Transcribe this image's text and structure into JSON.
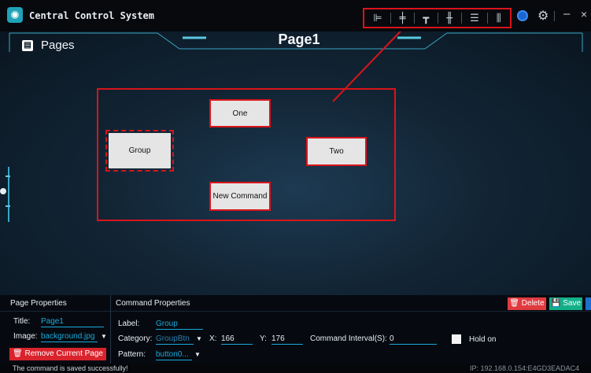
{
  "window": {
    "title": "Central Control System",
    "toolbar_icons": [
      "align-left-icon",
      "align-center-h-icon",
      "align-top-icon",
      "align-center-v-icon",
      "distribute-horizontal-icon",
      "distribute-vertical-icon"
    ],
    "toolbar_highlight_color": "#d9141b"
  },
  "canvas": {
    "pages_label": "Pages",
    "page_title": "Page1",
    "buttons": [
      {
        "label": "One",
        "selected": false
      },
      {
        "label": "Group",
        "selected": true
      },
      {
        "label": "Two",
        "selected": false
      },
      {
        "label": "New Command",
        "selected": false
      }
    ]
  },
  "page_props": {
    "heading": "Page Properties",
    "title_label": "Title:",
    "title_value": "Page1",
    "image_label": "Image:",
    "image_value": "background.jpg",
    "remove_label": "Remove Current Page"
  },
  "command_props": {
    "heading": "Command Properties",
    "delete_label": "Delete",
    "save_label": "Save",
    "label_label": "Label:",
    "label_value": "Group",
    "category_label": "Category:",
    "category_value": "GroupBtn",
    "x_label": "X:",
    "x_value": "166",
    "y_label": "Y:",
    "y_value": "176",
    "interval_label": "Command Interval(S):",
    "interval_value": "0",
    "hold_label": "Hold on",
    "pattern_label": "Pattern:",
    "pattern_value": "button0..."
  },
  "status": {
    "message": "The command is saved successfully!",
    "ip": "IP:  192.168.0.154:E4GD3EADAC4"
  }
}
